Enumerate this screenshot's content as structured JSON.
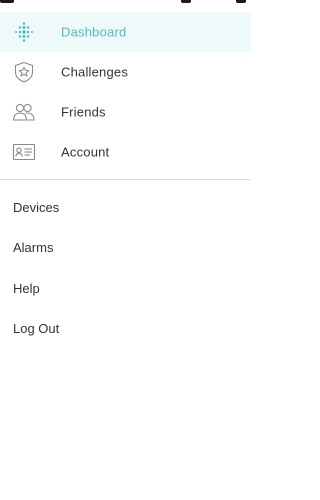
{
  "colors": {
    "accent": "#4cc2c4",
    "active_bg": "#eef9f9",
    "text": "#333333",
    "icon": "#8a8a8a",
    "divider": "#dcdcdc"
  },
  "main_nav": {
    "items": [
      {
        "label": "Dashboard",
        "icon": "fitbit-dots-icon",
        "active": true
      },
      {
        "label": "Challenges",
        "icon": "star-shield-icon",
        "active": false
      },
      {
        "label": "Friends",
        "icon": "friends-icon",
        "active": false
      },
      {
        "label": "Account",
        "icon": "id-card-icon",
        "active": false
      }
    ]
  },
  "secondary_nav": {
    "items": [
      {
        "label": "Devices"
      },
      {
        "label": "Alarms"
      },
      {
        "label": "Help"
      },
      {
        "label": "Log Out"
      }
    ]
  }
}
